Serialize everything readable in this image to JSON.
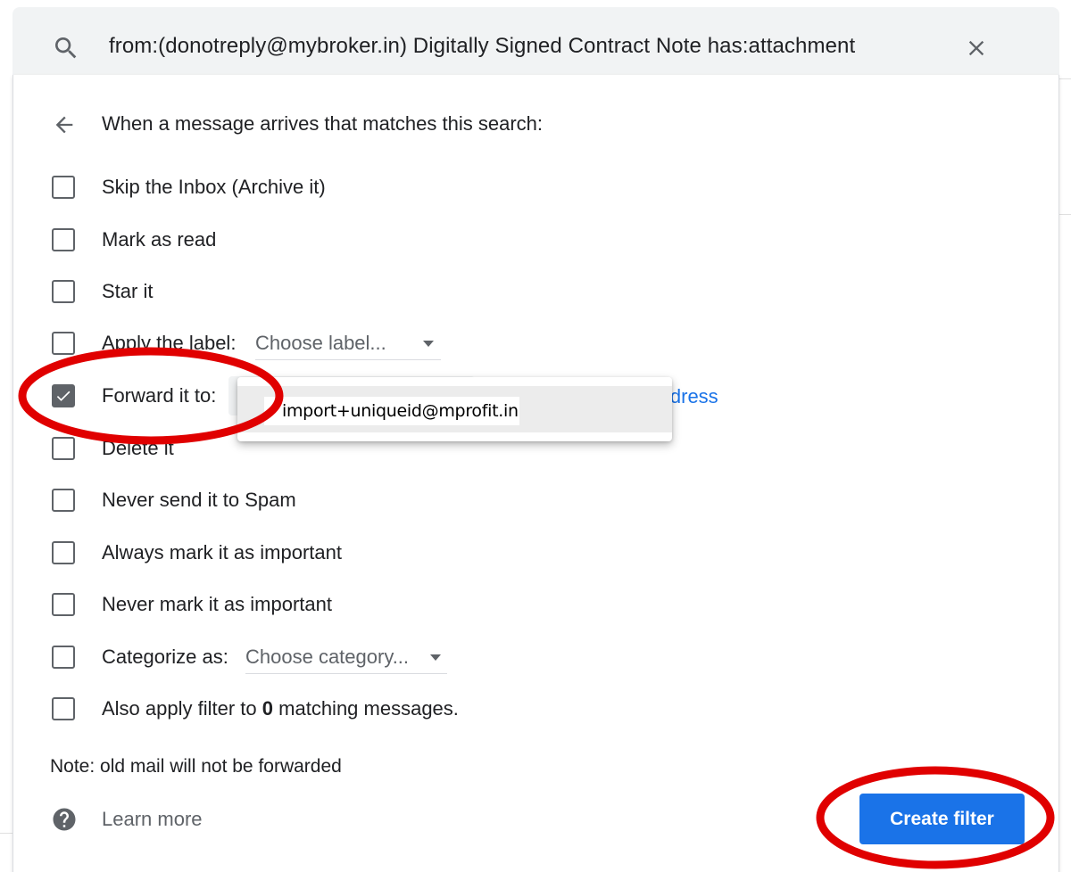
{
  "search": {
    "query": "from:(donotreply@mybroker.in) Digitally Signed Contract Note has:attachment"
  },
  "panel": {
    "header": "When a message arrives that matches this search:",
    "options": [
      {
        "label": "Skip the Inbox (Archive it)",
        "checked": false
      },
      {
        "label": "Mark as read",
        "checked": false
      },
      {
        "label": "Star it",
        "checked": false
      },
      {
        "label": "Apply the label:",
        "checked": false,
        "select_value": "Choose label..."
      },
      {
        "label": "Forward it to:",
        "checked": true,
        "link": "ldress"
      },
      {
        "label": "Delete it",
        "checked": false
      },
      {
        "label": "Never send it to Spam",
        "checked": false
      },
      {
        "label": "Always mark it as important",
        "checked": false
      },
      {
        "label": "Never mark it as important",
        "checked": false
      },
      {
        "label": "Categorize as:",
        "checked": false,
        "select_value": "Choose category..."
      },
      {
        "label_prefix": "Also apply filter to",
        "count": "0",
        "label_suffix": "matching messages.",
        "checked": false
      }
    ],
    "forward_dropdown": {
      "option": "import+uniqueid@mprofit.in"
    },
    "note": "Note: old mail will not be forwarded",
    "learn_more": "Learn more",
    "create_button": "Create filter"
  },
  "icons": {
    "search": "search-icon",
    "close": "close-icon",
    "back": "back-arrow-icon",
    "help": "help-icon",
    "check": "checkmark-icon"
  },
  "colors": {
    "accent": "#1a73e8",
    "annotation": "#e00000",
    "checkbox": "#5f6368",
    "search_bg": "#f1f3f4"
  }
}
